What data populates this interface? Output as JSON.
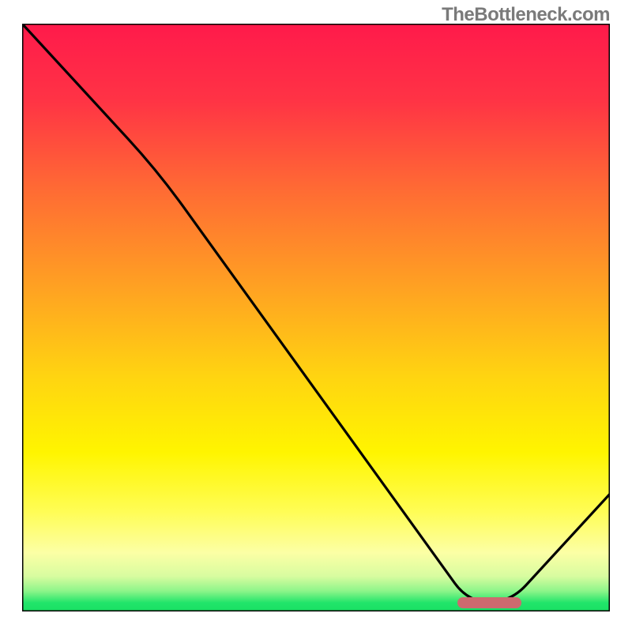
{
  "watermark": "TheBottleneck.com",
  "gradient": {
    "stops": [
      {
        "offset": 0.0,
        "color": "#ff1a4b"
      },
      {
        "offset": 0.13,
        "color": "#ff3345"
      },
      {
        "offset": 0.28,
        "color": "#ff6a34"
      },
      {
        "offset": 0.45,
        "color": "#ffa222"
      },
      {
        "offset": 0.6,
        "color": "#ffd411"
      },
      {
        "offset": 0.73,
        "color": "#fff500"
      },
      {
        "offset": 0.83,
        "color": "#fffd55"
      },
      {
        "offset": 0.9,
        "color": "#fcffa5"
      },
      {
        "offset": 0.94,
        "color": "#d8fca0"
      },
      {
        "offset": 0.965,
        "color": "#8ef58a"
      },
      {
        "offset": 0.985,
        "color": "#22e56a"
      },
      {
        "offset": 1.0,
        "color": "#18df63"
      }
    ]
  },
  "chart_data": {
    "type": "line",
    "title": "",
    "xlabel": "",
    "ylabel": "",
    "xlim": [
      0,
      100
    ],
    "ylim": [
      0,
      100
    ],
    "x": [
      0,
      23,
      76,
      83,
      100
    ],
    "values": [
      100,
      75,
      1.5,
      1.5,
      20
    ],
    "annotations": [
      {
        "kind": "optimal-marker",
        "x_start": 74,
        "x_end": 85,
        "y": 1.5
      }
    ]
  },
  "marker_color": "#cd6a6f"
}
